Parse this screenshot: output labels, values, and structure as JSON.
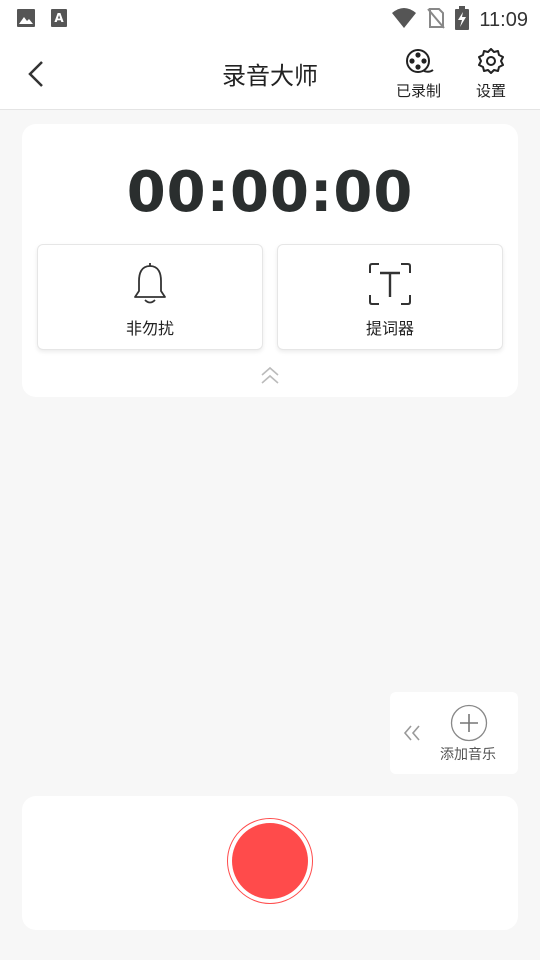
{
  "status_bar": {
    "time": "11:09",
    "icons": [
      "image-icon",
      "text-a-icon",
      "wifi-icon",
      "no-sim-icon",
      "battery-charging-icon"
    ]
  },
  "header": {
    "title": "录音大师",
    "back_icon": "chevron-left-icon",
    "recorded_label": "已录制",
    "recorded_icon": "film-reel-icon",
    "settings_label": "设置",
    "settings_icon": "gear-icon"
  },
  "timer": {
    "value": "00:00:00"
  },
  "tiles": {
    "dnd_label": "非勿扰",
    "dnd_icon": "bell-icon",
    "prompter_label": "提词器",
    "prompter_icon": "text-frame-icon"
  },
  "music": {
    "add_label": "添加音乐",
    "collapse_icon": "double-chevron-left-icon",
    "add_icon": "plus-circle-icon"
  },
  "colors": {
    "record_red": "#ff4b4b",
    "timer_text": "#2a2e2e",
    "background": "#f7f7f7"
  }
}
